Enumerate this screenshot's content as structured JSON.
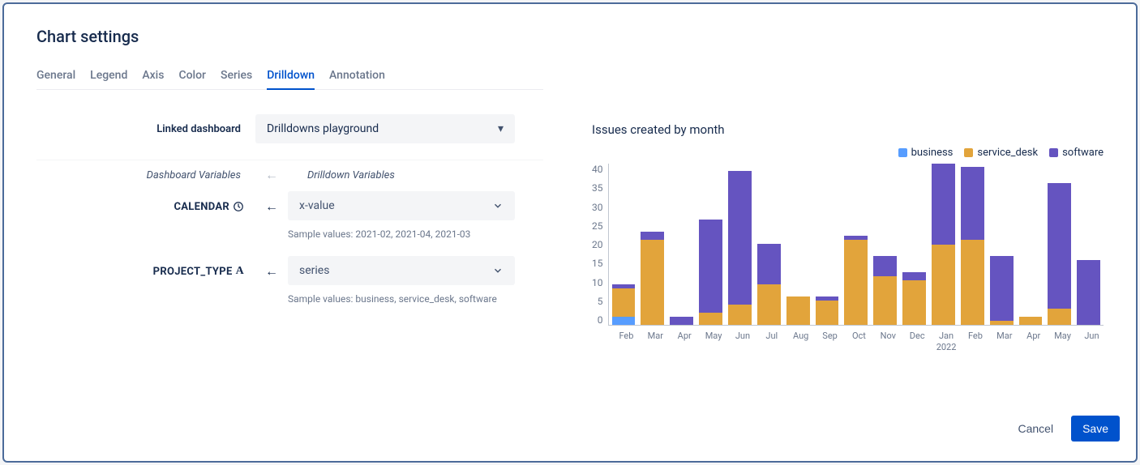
{
  "title": "Chart settings",
  "tabs": [
    {
      "label": "General"
    },
    {
      "label": "Legend"
    },
    {
      "label": "Axis"
    },
    {
      "label": "Color"
    },
    {
      "label": "Series"
    },
    {
      "label": "Drilldown",
      "active": true
    },
    {
      "label": "Annotation"
    }
  ],
  "linked_dashboard": {
    "label": "Linked dashboard",
    "value": "Drilldowns playground"
  },
  "headers": {
    "dashboard_variables": "Dashboard Variables",
    "drilldown_variables": "Drilldown Variables"
  },
  "variables": [
    {
      "name": "CALENDAR",
      "type_icon": "clock",
      "select_value": "x-value",
      "sample": "Sample values: 2021-02, 2021-04, 2021-03"
    },
    {
      "name": "PROJECT_TYPE",
      "type_icon": "text",
      "select_value": "series",
      "sample": "Sample values: business, service_desk, software"
    }
  ],
  "footer": {
    "cancel": "Cancel",
    "save": "Save"
  },
  "chart_data": {
    "type": "bar",
    "stacked": true,
    "title": "Issues created by month",
    "ylabel": "",
    "ylim": [
      0,
      40
    ],
    "yticks": [
      0,
      5,
      10,
      15,
      20,
      25,
      30,
      35,
      40
    ],
    "categories": [
      "Feb",
      "Mar",
      "Apr",
      "May",
      "Jun",
      "Jul",
      "Aug",
      "Sep",
      "Oct",
      "Nov",
      "Dec",
      "Jan 2022",
      "Feb",
      "Mar",
      "Apr",
      "May",
      "Jun"
    ],
    "legend": [
      "business",
      "service_desk",
      "software"
    ],
    "colors": {
      "business": "#579dff",
      "service_desk": "#e2a43b",
      "software": "#6554c0"
    },
    "series": [
      {
        "name": "business",
        "values": [
          2,
          0,
          0,
          0,
          0,
          0,
          0,
          0,
          0,
          0,
          0,
          0,
          0,
          0,
          0,
          0,
          0
        ]
      },
      {
        "name": "service_desk",
        "values": [
          7,
          21,
          0,
          3,
          5,
          10,
          7,
          6,
          21,
          12,
          11,
          20,
          21,
          1,
          2,
          4,
          0
        ]
      },
      {
        "name": "software",
        "values": [
          1,
          2,
          2,
          23,
          33,
          10,
          0,
          1,
          1,
          5,
          2,
          20,
          18,
          16,
          0,
          31,
          16
        ]
      }
    ]
  }
}
